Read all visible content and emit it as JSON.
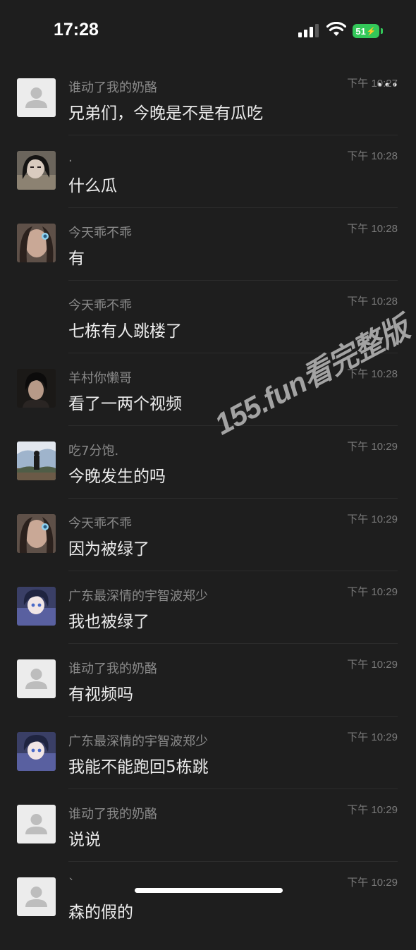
{
  "status_bar": {
    "time": "17:28",
    "battery": "51"
  },
  "messages": [
    {
      "sender": "谁动了我的奶酪",
      "time": "下午 10:27",
      "text": "兄弟们，今晚是不是有瓜吃",
      "avatar": "default-avatar"
    },
    {
      "sender": ".",
      "time": "下午 10:28",
      "text": "什么瓜",
      "avatar": "photo-girl"
    },
    {
      "sender": "今天乖不乖",
      "time": "下午 10:28",
      "text": "有",
      "avatar": "photo-girl-2"
    },
    {
      "sender": "今天乖不乖",
      "time": "下午 10:28",
      "text": "七栋有人跳楼了",
      "avatar": ""
    },
    {
      "sender": "羊村你懒哥",
      "time": "下午 10:28",
      "text": "看了一两个视频",
      "avatar": "photo-boy"
    },
    {
      "sender": "吃7分饱.",
      "time": "下午 10:29",
      "text": "今晚发生的吗",
      "avatar": "photo-landscape"
    },
    {
      "sender": "今天乖不乖",
      "time": "下午 10:29",
      "text": "因为被绿了",
      "avatar": "photo-girl-2"
    },
    {
      "sender": "广东最深情的宇智波郑少",
      "time": "下午 10:29",
      "text": "我也被绿了",
      "avatar": "anime-avatar"
    },
    {
      "sender": "谁动了我的奶酪",
      "time": "下午 10:29",
      "text": "有视频吗",
      "avatar": "default-avatar"
    },
    {
      "sender": "广东最深情的宇智波郑少",
      "time": "下午 10:29",
      "text": "我能不能跑回5栋跳",
      "avatar": "anime-avatar"
    },
    {
      "sender": "谁动了我的奶酪",
      "time": "下午 10:29",
      "text": "说说",
      "avatar": "default-avatar"
    },
    {
      "sender": "`",
      "time": "下午 10:29",
      "text": "森的假的",
      "avatar": "default-avatar"
    }
  ],
  "watermark": "155.fun看完整版"
}
